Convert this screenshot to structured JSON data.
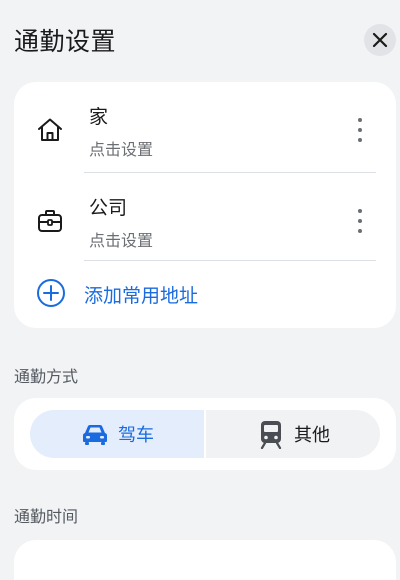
{
  "header": {
    "title": "通勤设置",
    "close_icon": "close-icon"
  },
  "addresses": {
    "items": [
      {
        "name": "家",
        "subtitle": "点击设置",
        "icon": "home-icon"
      },
      {
        "name": "公司",
        "subtitle": "点击设置",
        "icon": "briefcase-icon"
      }
    ],
    "add_label": "添加常用地址",
    "add_icon": "plus-circle-icon"
  },
  "commute_mode": {
    "label": "通勤方式",
    "options": [
      {
        "label": "驾车",
        "icon": "car-icon",
        "selected": true
      },
      {
        "label": "其他",
        "icon": "train-icon",
        "selected": false
      }
    ]
  },
  "commute_time": {
    "label": "通勤时间"
  },
  "colors": {
    "accent": "#1a6be0",
    "background": "#f1f3f5",
    "card": "#ffffff",
    "selected_segment": "#e3edfc"
  }
}
